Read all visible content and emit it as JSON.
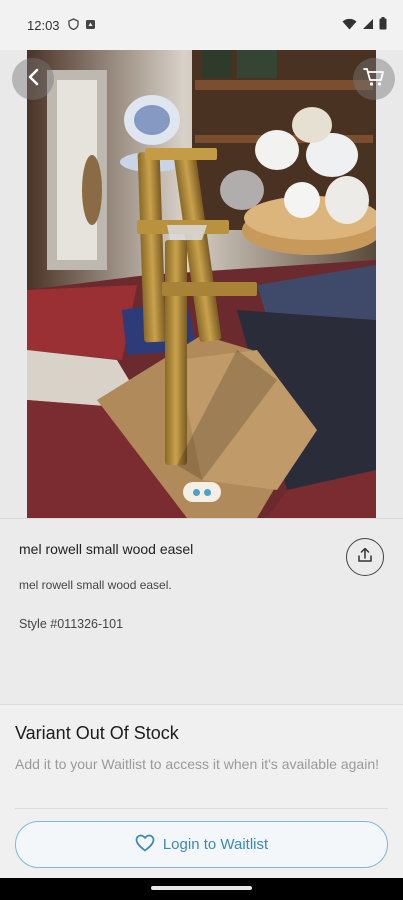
{
  "status_bar": {
    "time": "12:03"
  },
  "product": {
    "title": "mel rowell small wood easel",
    "description": "mel rowell small wood easel.",
    "style": "Style #011326-101",
    "image_count": 2
  },
  "waitlist": {
    "heading": "Variant Out Of Stock",
    "subtext": "Add it to your Waitlist to access it when it's available again!",
    "button_label": "Login to Waitlist"
  },
  "colors": {
    "accent": "#3c8ab3",
    "button_border": "#7fb9d6",
    "background": "#ebebeb"
  },
  "icons": {
    "back": "chevron-left-icon",
    "cart": "cart-icon",
    "share": "share-icon",
    "waitlist": "heart-icon"
  }
}
